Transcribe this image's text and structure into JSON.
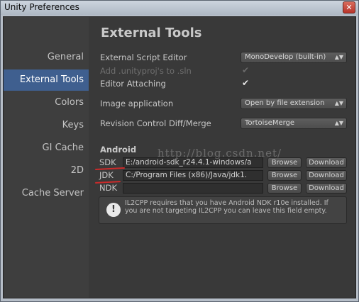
{
  "window": {
    "title": "Unity Preferences",
    "close_glyph": "✕"
  },
  "sidebar": {
    "items": [
      {
        "label": "General",
        "active": false
      },
      {
        "label": "External Tools",
        "active": true
      },
      {
        "label": "Colors",
        "active": false
      },
      {
        "label": "Keys",
        "active": false
      },
      {
        "label": "GI Cache",
        "active": false
      },
      {
        "label": "2D",
        "active": false
      },
      {
        "label": "Cache Server",
        "active": false
      }
    ]
  },
  "main": {
    "heading": "External Tools",
    "script_editor": {
      "label": "External Script Editor",
      "value": "MonoDevelop (built-in)"
    },
    "add_unityproj": {
      "label": "Add .unityproj's to .sln",
      "checked": true,
      "enabled": false
    },
    "editor_attaching": {
      "label": "Editor Attaching",
      "checked": true
    },
    "image_application": {
      "label": "Image application",
      "value": "Open by file extension"
    },
    "revision_control": {
      "label": "Revision Control Diff/Merge",
      "value": "TortoiseMerge"
    },
    "android": {
      "section_label": "Android",
      "sdk": {
        "label": "SDK",
        "value": "E:/android-sdk_r24.4.1-windows/a"
      },
      "jdk": {
        "label": "JDK",
        "value": "C:/Program Files (x86)/Java/jdk1."
      },
      "ndk": {
        "label": "NDK",
        "value": ""
      },
      "browse_label": "Browse",
      "download_label": "Download"
    },
    "help": {
      "icon": "!",
      "text": "IL2CPP requires that you have Android NDK r10e installed. If you are not targeting IL2CPP you can leave this field empty."
    },
    "watermark": "http://blog.csdn.net/"
  },
  "colors": {
    "active_tab": "#3f5f8f",
    "panel_bg": "#393939",
    "annotation_red": "#cc2b2b"
  },
  "icons": {
    "checkmark": "✔",
    "dropdown_arrow": "▲▼"
  }
}
